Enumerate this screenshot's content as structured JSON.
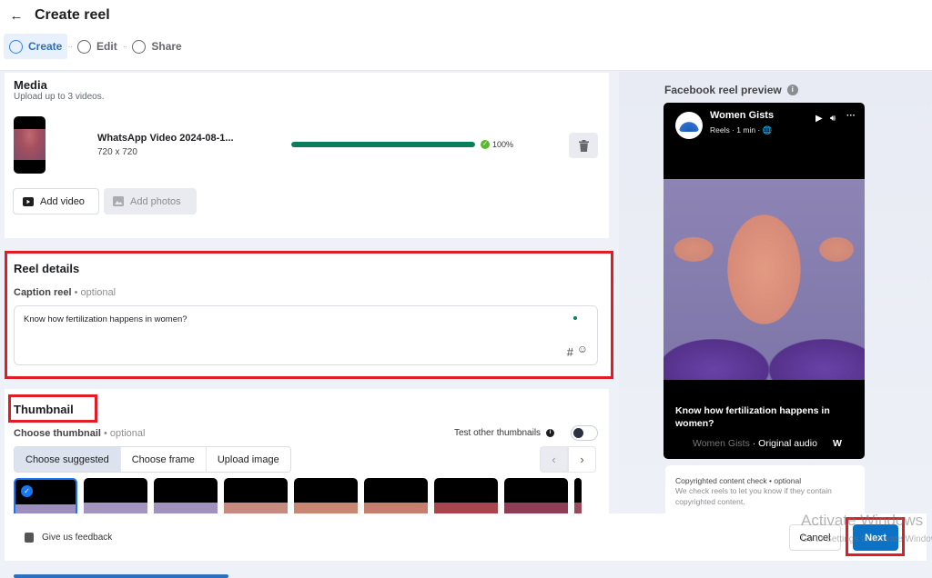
{
  "header": {
    "title": "Create reel",
    "steps": [
      {
        "label": "Create",
        "active": true
      },
      {
        "label": "Edit",
        "active": false
      },
      {
        "label": "Share",
        "active": false
      }
    ]
  },
  "media": {
    "title": "Media",
    "subtitle": "Upload up to 3 videos.",
    "file": {
      "name": "WhatsApp Video 2024-08-1...",
      "dimensions": "720 x 720",
      "progress": 100,
      "progress_label": "100%"
    },
    "add_video_label": "Add video",
    "add_photos_label": "Add photos"
  },
  "reel_details": {
    "title": "Reel details",
    "caption_label": "Caption reel",
    "optional_label": "• optional",
    "caption_value": "Know how fertilization happens in women?",
    "hashtag_icon": "#",
    "emoji_icon": "☺"
  },
  "thumbnail": {
    "title": "Thumbnail",
    "choose_label": "Choose thumbnail",
    "optional_label": "• optional",
    "test_other_label": "Test other thumbnails",
    "test_other_enabled": false,
    "tabs": [
      {
        "label": "Choose suggested",
        "active": true
      },
      {
        "label": "Choose frame",
        "active": false
      },
      {
        "label": "Upload image",
        "active": false
      }
    ],
    "thumb_count": 9,
    "selected_index": 0
  },
  "footer": {
    "feedback_label": "Give us feedback",
    "cancel_label": "Cancel",
    "next_label": "Next"
  },
  "preview": {
    "title": "Facebook reel preview",
    "page_name": "Women Gists",
    "meta": "Reels · 1 min · 🌐",
    "caption": "Know how fertilization happens in women?",
    "audio_faded": "Women Gists",
    "audio": " · Original audio",
    "audio_next": "W",
    "copyright_title": "Copyrighted content check • optional",
    "copyright_text": "We check reels to let you know if they contain copyrighted content."
  },
  "watermark": {
    "line1": "Activate Windows",
    "line2": "Go to Settings to activate Windows."
  },
  "colors": {
    "primary": "#0b72c6",
    "progress": "#0a7d5a",
    "highlight_red": "#e21c24"
  }
}
